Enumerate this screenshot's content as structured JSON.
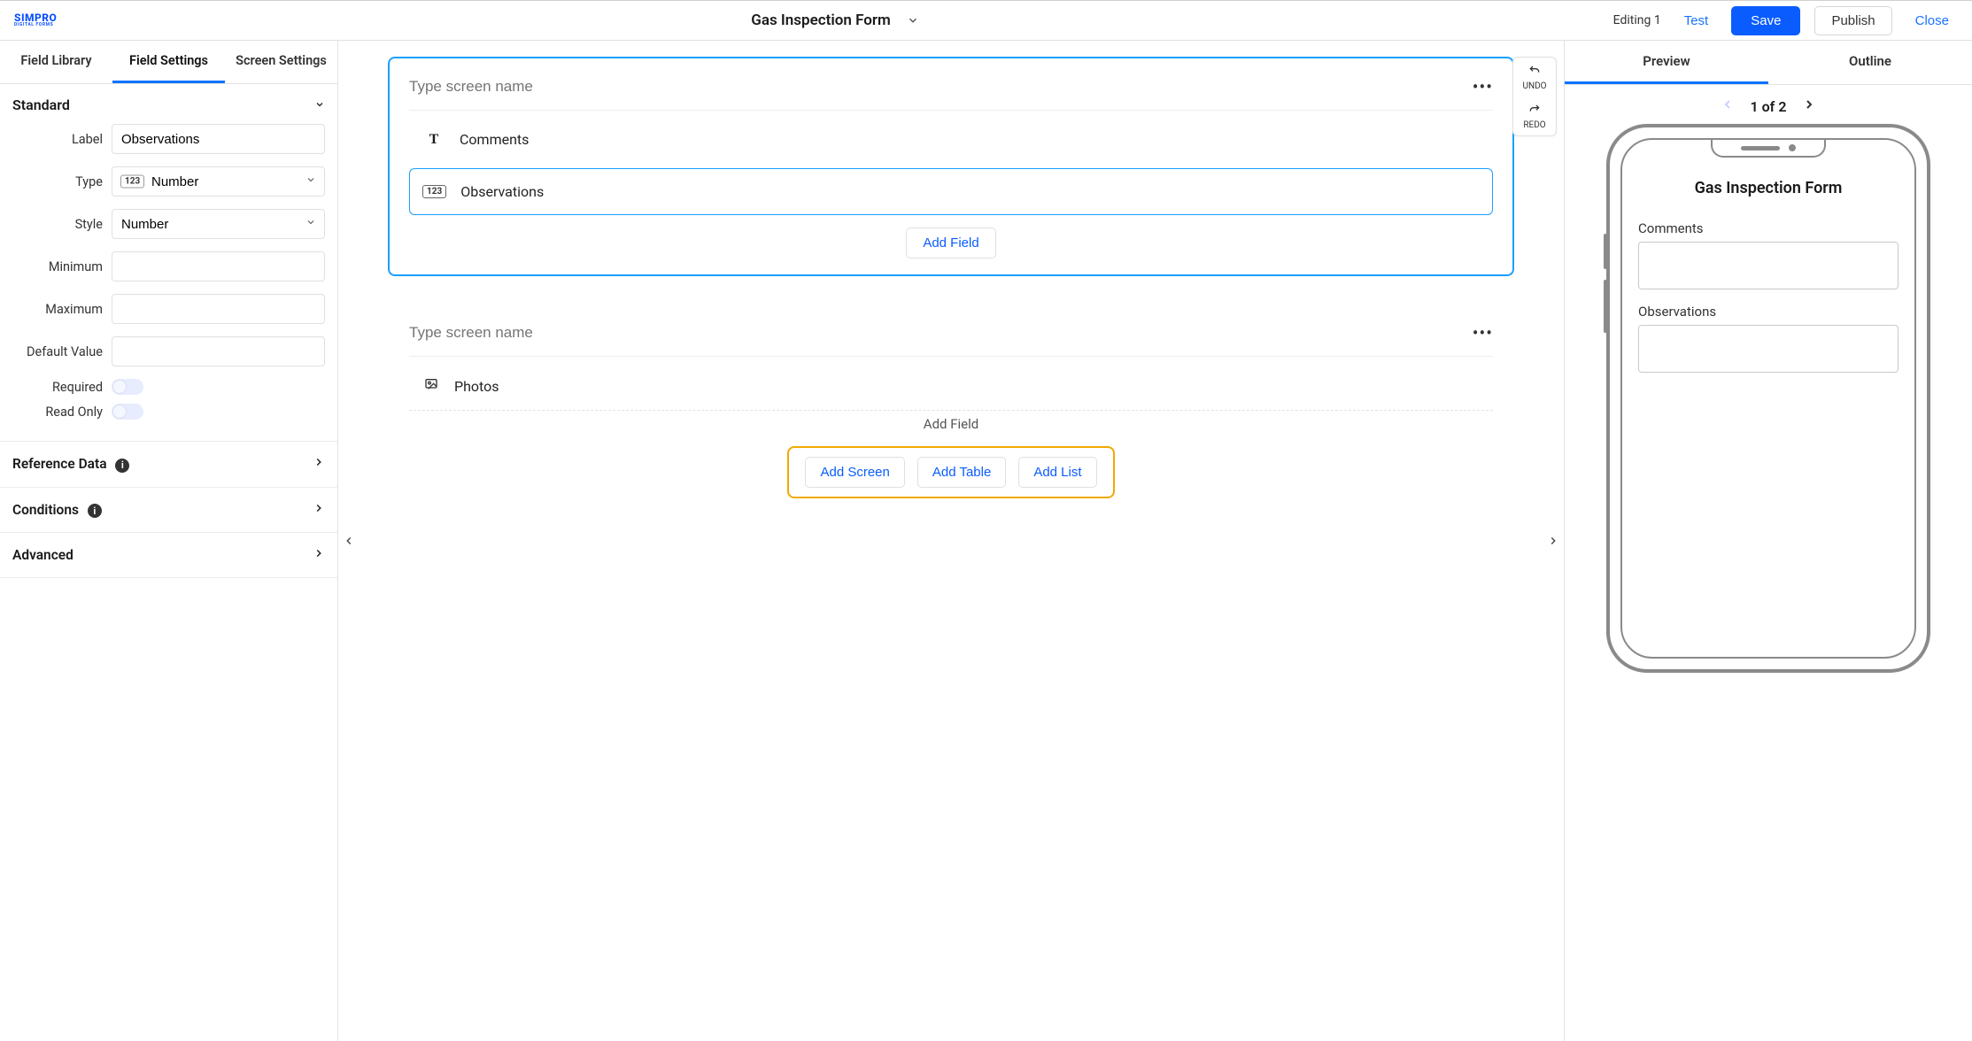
{
  "header": {
    "logo_main": "SIMPRO",
    "logo_sub": "DIGITAL FORMS",
    "form_title": "Gas Inspection Form",
    "editing_status": "Editing 1",
    "test_label": "Test",
    "save_label": "Save",
    "publish_label": "Publish",
    "close_label": "Close"
  },
  "left_tabs": {
    "field_library": "Field Library",
    "field_settings": "Field Settings",
    "screen_settings": "Screen Settings",
    "active": "field_settings"
  },
  "settings": {
    "section_title": "Standard",
    "labels": {
      "label": "Label",
      "type": "Type",
      "style": "Style",
      "minimum": "Minimum",
      "maximum": "Maximum",
      "default_value": "Default Value",
      "required": "Required",
      "read_only": "Read Only"
    },
    "values": {
      "label": "Observations",
      "type": "Number",
      "type_prefix": "123",
      "style": "Number",
      "minimum": "",
      "maximum": "",
      "default_value": ""
    },
    "toggles": {
      "required": false,
      "read_only": false
    },
    "sections": {
      "reference_data": "Reference Data",
      "conditions": "Conditions",
      "advanced": "Advanced"
    }
  },
  "canvas": {
    "undo_label": "UNDO",
    "redo_label": "REDO",
    "screens": [
      {
        "name_placeholder": "Type screen name",
        "name_value": "",
        "selected": true,
        "fields": [
          {
            "icon": "text",
            "label": "Comments",
            "selected": false
          },
          {
            "icon": "number",
            "label": "Observations",
            "selected": true
          }
        ],
        "add_field_label": "Add Field"
      },
      {
        "name_placeholder": "Type screen name",
        "name_value": "",
        "selected": false,
        "fields": [
          {
            "icon": "image",
            "label": "Photos",
            "selected": false
          }
        ],
        "add_field_label": "Add Field"
      }
    ],
    "add_bar": {
      "add_screen": "Add Screen",
      "add_table": "Add Table",
      "add_list": "Add List"
    }
  },
  "right_tabs": {
    "preview": "Preview",
    "outline": "Outline",
    "active": "preview"
  },
  "preview": {
    "pager_text": "1 of 2",
    "form_title": "Gas Inspection Form",
    "fields": [
      {
        "label": "Comments"
      },
      {
        "label": "Observations"
      }
    ]
  }
}
